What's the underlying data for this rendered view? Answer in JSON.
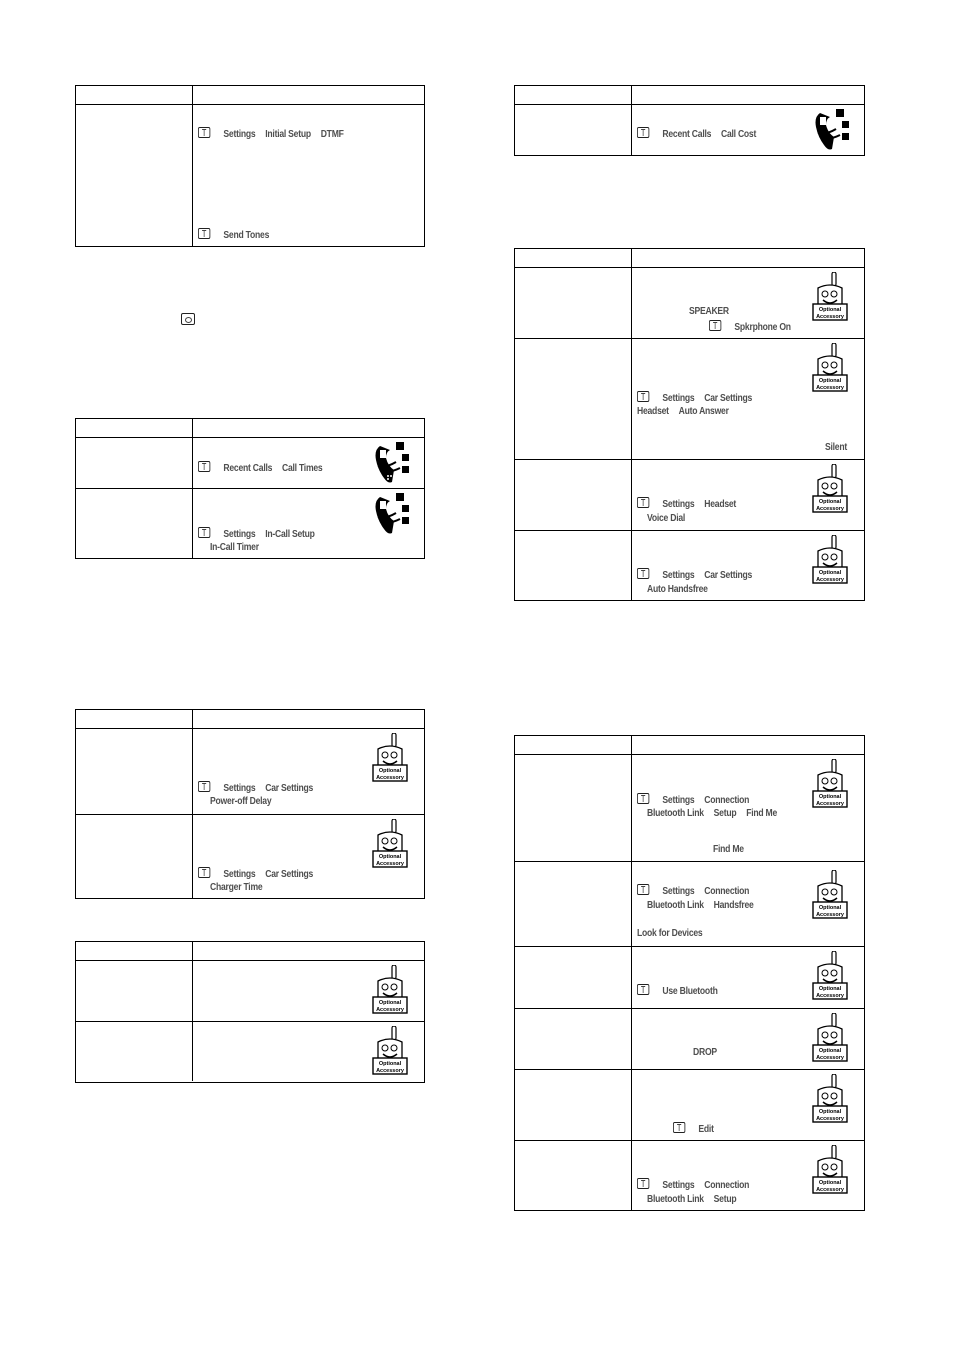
{
  "document": {
    "left_column": {
      "dtmf_table": {
        "rows": [
          {
            "lines": [
              {
                "menu_key": true,
                "items": [
                  "Settings",
                  "Initial Setup",
                  "DTMF"
                ]
              },
              {
                "menu_key": true,
                "items": [
                  "Send Tones"
                ]
              }
            ]
          }
        ]
      },
      "end_key_icon": "end-call-key-icon",
      "call_times_table": {
        "rows": [
          {
            "icon": "network-feature-icon",
            "lines": [
              {
                "menu_key": true,
                "items": [
                  "Recent Calls",
                  "Call Times"
                ]
              }
            ]
          },
          {
            "icon": "network-feature-icon",
            "lines": [
              {
                "menu_key": true,
                "items": [
                  "Settings",
                  "In-Call Setup"
                ]
              },
              {
                "menu_key": false,
                "items": [
                  "In-Call Timer"
                ]
              }
            ]
          }
        ]
      },
      "car_kit_table": {
        "rows": [
          {
            "icon": "optional-accessory-icon",
            "lines": [
              {
                "menu_key": true,
                "items": [
                  "Settings",
                  "Car Settings"
                ]
              },
              {
                "menu_key": false,
                "items": [
                  "Power-off Delay"
                ]
              }
            ]
          },
          {
            "icon": "optional-accessory-icon",
            "lines": [
              {
                "menu_key": true,
                "items": [
                  "Settings",
                  "Car Settings"
                ]
              },
              {
                "menu_key": false,
                "items": [
                  "Charger Time"
                ]
              }
            ]
          }
        ]
      },
      "accessory_table": {
        "rows": [
          {
            "icon": "optional-accessory-icon",
            "lines": []
          },
          {
            "icon": "optional-accessory-icon",
            "lines": []
          }
        ]
      }
    },
    "right_column": {
      "call_cost_table": {
        "rows": [
          {
            "icon": "network-feature-icon",
            "lines": [
              {
                "menu_key": true,
                "items": [
                  "Recent Calls",
                  "Call Cost"
                ]
              }
            ]
          }
        ]
      },
      "handsfree_table": {
        "rows": [
          {
            "icon": "optional-accessory-icon",
            "lines": [
              {
                "menu_key": false,
                "items": [
                  "SPEAKER"
                ]
              },
              {
                "menu_key": true,
                "items": [
                  "Spkrphone On"
                ]
              }
            ]
          },
          {
            "icon": "optional-accessory-icon",
            "lines": [
              {
                "menu_key": true,
                "items": [
                  "Settings",
                  "Car Settings"
                ]
              },
              {
                "menu_key": false,
                "items": [
                  "Headset",
                  "Auto Answer"
                ]
              },
              {
                "menu_key": false,
                "items": [
                  "Silent"
                ]
              }
            ]
          },
          {
            "icon": "optional-accessory-icon",
            "lines": [
              {
                "menu_key": true,
                "items": [
                  "Settings",
                  "Headset"
                ]
              },
              {
                "menu_key": false,
                "items": [
                  "Voice Dial"
                ]
              }
            ]
          },
          {
            "icon": "optional-accessory-icon",
            "lines": [
              {
                "menu_key": true,
                "items": [
                  "Settings",
                  "Car Settings"
                ]
              },
              {
                "menu_key": false,
                "items": [
                  "Auto Handsfree"
                ]
              }
            ]
          }
        ]
      },
      "bluetooth_table": {
        "rows": [
          {
            "icon": "optional-accessory-icon",
            "lines": [
              {
                "menu_key": true,
                "items": [
                  "Settings",
                  "Connection"
                ]
              },
              {
                "menu_key": false,
                "items": [
                  "Bluetooth Link",
                  "Setup",
                  "Find Me"
                ]
              },
              {
                "menu_key": false,
                "items": [
                  "Find Me"
                ]
              }
            ]
          },
          {
            "icon": "optional-accessory-icon",
            "lines": [
              {
                "menu_key": true,
                "items": [
                  "Settings",
                  "Connection"
                ]
              },
              {
                "menu_key": false,
                "items": [
                  "Bluetooth Link",
                  "Handsfree"
                ]
              },
              {
                "menu_key": false,
                "items": [
                  "Look for Devices"
                ]
              }
            ]
          },
          {
            "icon": "optional-accessory-icon",
            "lines": [
              {
                "menu_key": true,
                "items": [
                  "Use Bluetooth"
                ]
              }
            ]
          },
          {
            "icon": "optional-accessory-icon",
            "lines": [
              {
                "menu_key": false,
                "items": [
                  "DROP"
                ]
              }
            ]
          },
          {
            "icon": "optional-accessory-icon",
            "lines": [
              {
                "menu_key": true,
                "items": [
                  "Edit"
                ]
              }
            ]
          },
          {
            "icon": "optional-accessory-icon",
            "lines": [
              {
                "menu_key": true,
                "items": [
                  "Settings",
                  "Connection"
                ]
              },
              {
                "menu_key": false,
                "items": [
                  "Bluetooth Link",
                  "Setup"
                ]
              }
            ]
          }
        ]
      }
    },
    "accessory_badge": {
      "line1": "Optional",
      "line2": "Accessory"
    }
  }
}
